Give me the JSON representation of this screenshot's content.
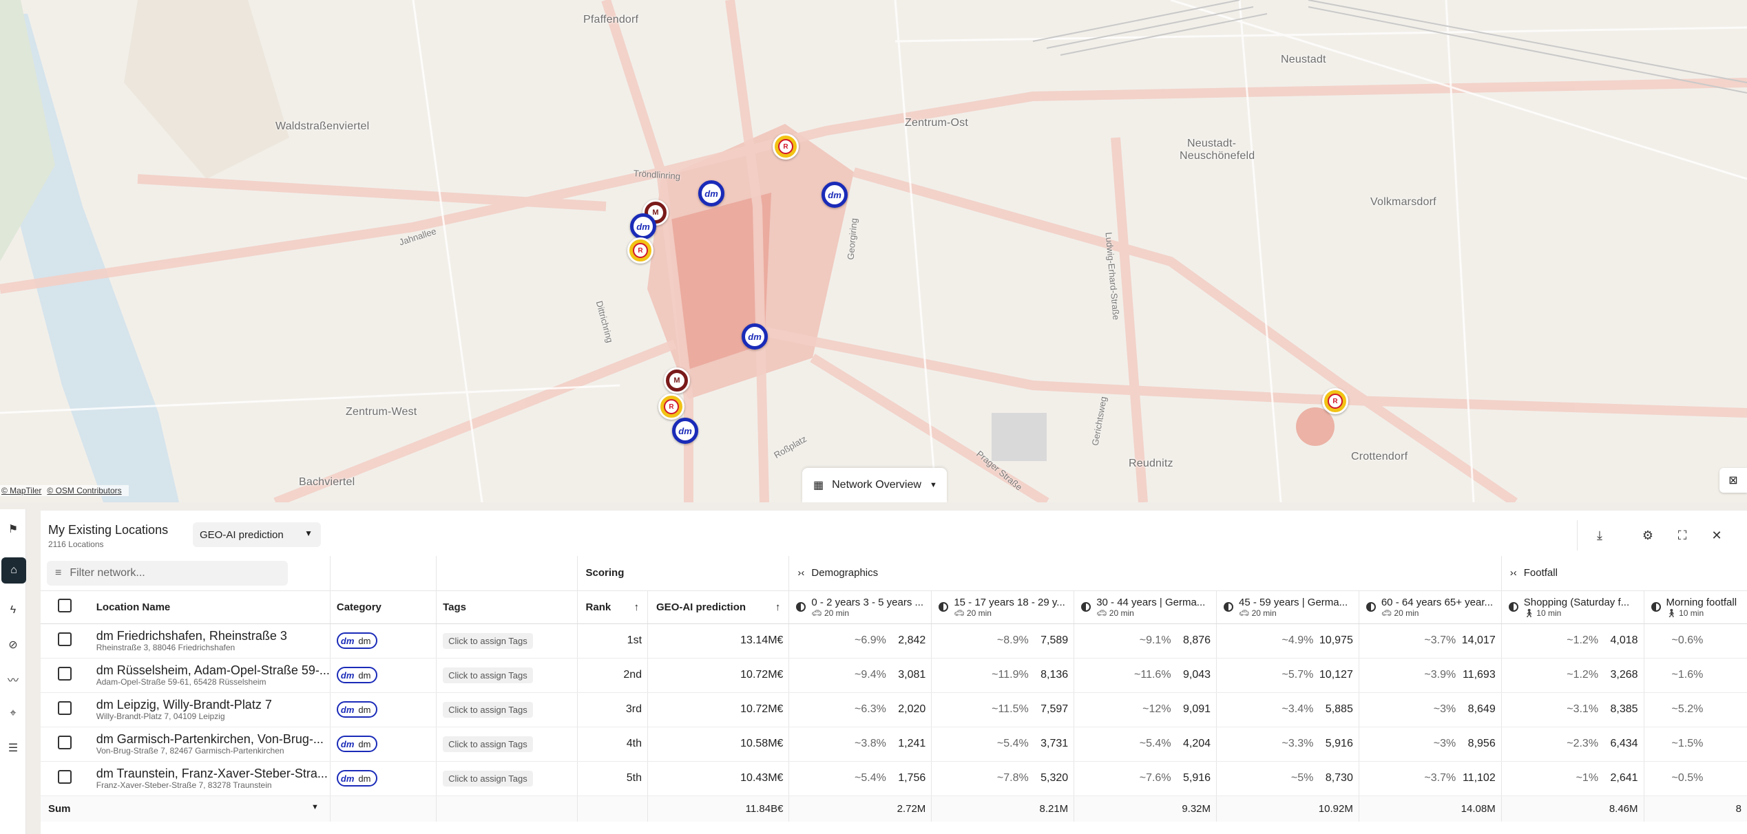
{
  "map": {
    "places": [
      "Pfaffendorf",
      "Neustadt",
      "Waldstraßenviertel",
      "Zentrum-Ost",
      "Neustadt-\nNeuschönefeld",
      "Volkmarsdorf",
      "Zentrum-West",
      "Bachviertel",
      "Reudnitz",
      "Crottendorf"
    ],
    "places_list": [
      {
        "name": "Pfaffendorf"
      },
      {
        "name": "Neustadt"
      },
      {
        "name": "Waldstraßenviertel"
      },
      {
        "name": "Zentrum-Ost"
      },
      {
        "name": "Neustadt-"
      },
      {
        "name": "Neuschönefeld"
      },
      {
        "name": "Volkmarsdorf"
      },
      {
        "name": "Zentrum-West"
      },
      {
        "name": "Bachviertel"
      },
      {
        "name": "Reudnitz"
      },
      {
        "name": "Crottendorf"
      }
    ],
    "streets": [
      "Tröndlinring",
      "Jahnallee",
      "Dittrichring",
      "Georgiring",
      "Ludwig-Erhard-Straße",
      "Roßplatz",
      "Prager Straße",
      "Gerichtsweg"
    ],
    "attribution": [
      "© MapTiler",
      "© OSM Contributors"
    ],
    "network_button": "Network Overview",
    "marker_label_dm": "dm",
    "marker_label_ross": "R",
    "marker_label_mk": "M"
  },
  "panel": {
    "title": "My Existing Locations",
    "subtitle": "2116 Locations",
    "prediction_select": "GEO-AI prediction",
    "filter_placeholder": "Filter network...",
    "group_scoring": "Scoring",
    "group_demographics": "Demographics",
    "group_footfall": "Footfall",
    "headers": {
      "location_name": "Location Name",
      "category": "Category",
      "tags": "Tags",
      "rank": "Rank",
      "prediction": "GEO-AI prediction"
    },
    "demo_cols": [
      {
        "title": "0 - 2 years 3 - 5 years ...",
        "sub": "20 min"
      },
      {
        "title": "15 - 17 years 18 - 29 y...",
        "sub": "20 min"
      },
      {
        "title": "30 - 44 years | Germa...",
        "sub": "20 min"
      },
      {
        "title": "45 - 59 years | Germa...",
        "sub": "20 min"
      },
      {
        "title": "60 - 64 years 65+ year...",
        "sub": "20 min"
      }
    ],
    "foot_cols": [
      {
        "title": "Shopping (Saturday f...",
        "sub": "10 min"
      },
      {
        "title": "Morning footfall",
        "sub": "10 min"
      }
    ],
    "tag_button": "Click to assign Tags",
    "category_label": "dm",
    "rows": [
      {
        "name": "dm Friedrichshafen, Rheinstraße 3",
        "addr": "Rheinstraße 3, 88046 Friedrichshafen",
        "rank": "1st",
        "pred": "13.14M€",
        "vals": [
          [
            "~6.9%",
            "2,842"
          ],
          [
            "~8.9%",
            "7,589"
          ],
          [
            "~9.1%",
            "8,876"
          ],
          [
            "~4.9%",
            "10,975"
          ],
          [
            "~3.7%",
            "14,017"
          ],
          [
            "~1.2%",
            "4,018"
          ],
          [
            "~0.6%",
            ""
          ]
        ]
      },
      {
        "name": "dm Rüsselsheim, Adam-Opel-Straße 59-...",
        "addr": "Adam-Opel-Straße 59-61, 65428 Rüsselsheim",
        "rank": "2nd",
        "pred": "10.72M€",
        "vals": [
          [
            "~9.4%",
            "3,081"
          ],
          [
            "~11.9%",
            "8,136"
          ],
          [
            "~11.6%",
            "9,043"
          ],
          [
            "~5.7%",
            "10,127"
          ],
          [
            "~3.9%",
            "11,693"
          ],
          [
            "~1.2%",
            "3,268"
          ],
          [
            "~1.6%",
            ""
          ]
        ]
      },
      {
        "name": "dm Leipzig, Willy-Brandt-Platz 7",
        "addr": "Willy-Brandt-Platz 7, 04109 Leipzig",
        "rank": "3rd",
        "pred": "10.72M€",
        "vals": [
          [
            "~6.3%",
            "2,020"
          ],
          [
            "~11.5%",
            "7,597"
          ],
          [
            "~12%",
            "9,091"
          ],
          [
            "~3.4%",
            "5,885"
          ],
          [
            "~3%",
            "8,649"
          ],
          [
            "~3.1%",
            "8,385"
          ],
          [
            "~5.2%",
            ""
          ]
        ]
      },
      {
        "name": "dm Garmisch-Partenkirchen, Von-Brug-...",
        "addr": "Von-Brug-Straße 7, 82467 Garmisch-Partenkirchen",
        "rank": "4th",
        "pred": "10.58M€",
        "vals": [
          [
            "~3.8%",
            "1,241"
          ],
          [
            "~5.4%",
            "3,731"
          ],
          [
            "~5.4%",
            "4,204"
          ],
          [
            "~3.3%",
            "5,916"
          ],
          [
            "~3%",
            "8,956"
          ],
          [
            "~2.3%",
            "6,434"
          ],
          [
            "~1.5%",
            ""
          ]
        ]
      },
      {
        "name": "dm Traunstein, Franz-Xaver-Steber-Stra...",
        "addr": "Franz-Xaver-Steber-Straße 7, 83278 Traunstein",
        "rank": "5th",
        "pred": "10.43M€",
        "vals": [
          [
            "~5.4%",
            "1,756"
          ],
          [
            "~7.8%",
            "5,320"
          ],
          [
            "~7.6%",
            "5,916"
          ],
          [
            "~5%",
            "8,730"
          ],
          [
            "~3.7%",
            "11,102"
          ],
          [
            "~1%",
            "2,641"
          ],
          [
            "~0.5%",
            ""
          ]
        ]
      }
    ],
    "sum": {
      "label": "Sum",
      "pred": "11.84B€",
      "vals": [
        "2.72M",
        "8.21M",
        "9.32M",
        "10.92M",
        "14.08M",
        "8.46M",
        "8"
      ]
    }
  }
}
